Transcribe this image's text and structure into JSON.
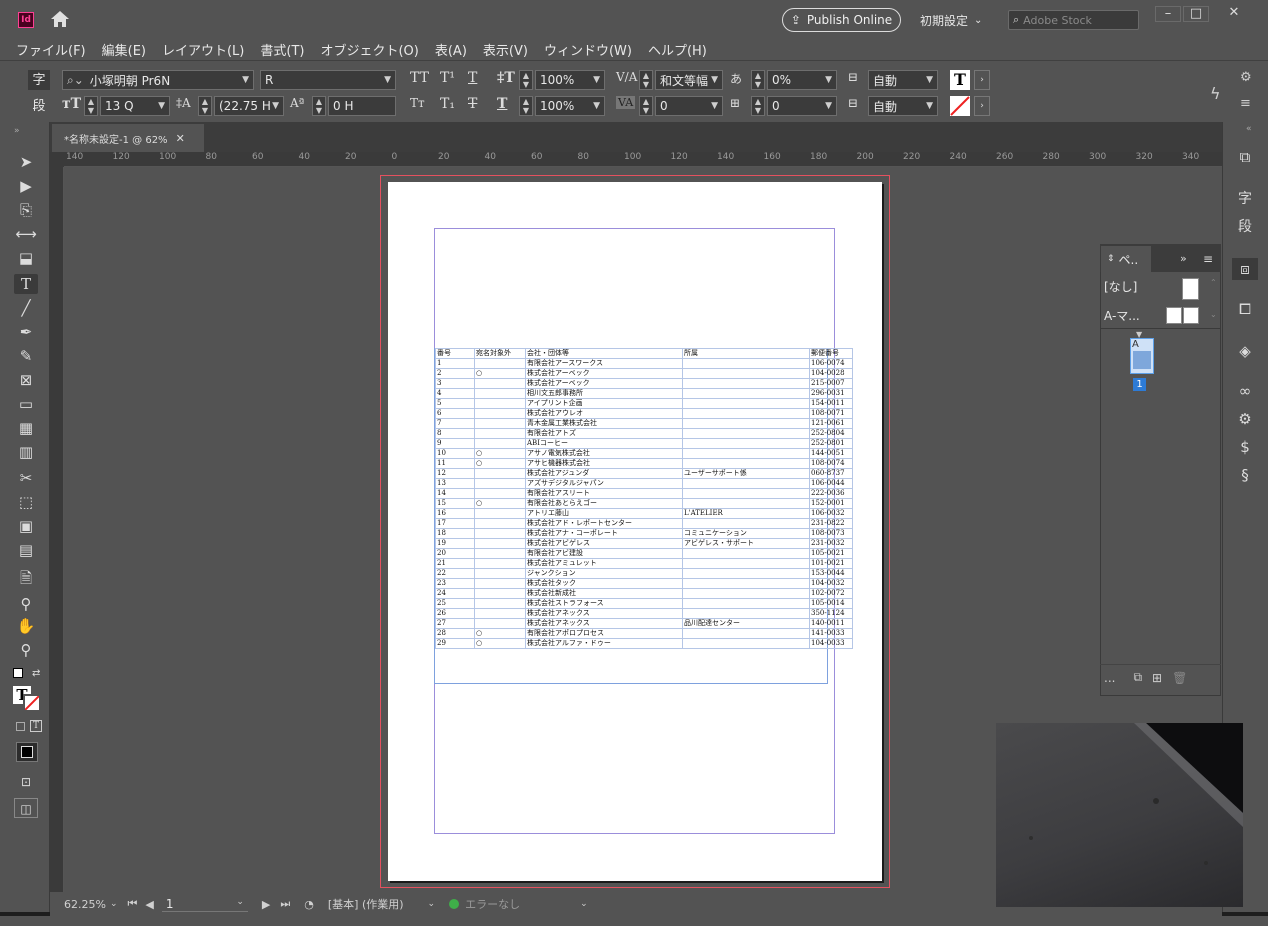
{
  "titlebar": {
    "app_logo": "Id",
    "publish_label": "Publish Online",
    "workspace_label": "初期設定",
    "stock_placeholder": "Adobe Stock"
  },
  "menu": [
    "ファイル(F)",
    "編集(E)",
    "レイアウト(L)",
    "書式(T)",
    "オブジェクト(O)",
    "表(A)",
    "表示(V)",
    "ウィンドウ(W)",
    "ヘルプ(H)"
  ],
  "control": {
    "char_mode": "字",
    "para_mode": "段",
    "font_family": "小塚明朝 Pr6N",
    "font_style": "R",
    "font_size": "13 Q",
    "leading": "(22.75 H",
    "baseline_shift": "0 H",
    "vertical_scale": "100%",
    "horizontal_scale": "100%",
    "kerning": "和文等幅",
    "tracking": "0",
    "tsume": "0%",
    "aki_value": "0",
    "auto1": "自動",
    "auto2": "自動"
  },
  "document_tab": {
    "title": "*名称未設定-1 @ 62%"
  },
  "ruler_labels": [
    "140",
    "120",
    "100",
    "80",
    "60",
    "40",
    "20",
    "0",
    "20",
    "40",
    "60",
    "80",
    "100",
    "120",
    "140",
    "160",
    "180",
    "200",
    "220",
    "240",
    "260",
    "280",
    "300",
    "320",
    "340"
  ],
  "table": {
    "headers": [
      "番号",
      "宛名対象外",
      "会社・団体等",
      "所属",
      "郵便番号"
    ],
    "rows": [
      [
        "1",
        "",
        "有限会社アースワークス",
        "",
        "106-0074"
      ],
      [
        "2",
        "○",
        "株式会社アーベック",
        "",
        "104-0028"
      ],
      [
        "3",
        "",
        "株式会社アーベック",
        "",
        "215-0007"
      ],
      [
        "4",
        "",
        "相川文五郎事務所",
        "",
        "296-0031"
      ],
      [
        "5",
        "",
        "アイプリント企画",
        "",
        "154-0011"
      ],
      [
        "6",
        "",
        "株式会社アウレオ",
        "",
        "108-0071"
      ],
      [
        "7",
        "",
        "青木金属工業株式会社",
        "",
        "121-0061"
      ],
      [
        "8",
        "",
        "有限会社アトズ",
        "",
        "252-0804"
      ],
      [
        "9",
        "",
        "ABIコーヒー",
        "",
        "252-0801"
      ],
      [
        "10",
        "○",
        "アサノ電気株式会社",
        "",
        "144-0051"
      ],
      [
        "11",
        "○",
        "アサヒ機器株式会社",
        "",
        "108-0074"
      ],
      [
        "12",
        "",
        "株式会社アジュンダ",
        "ユーザーサポート係",
        "060-8737"
      ],
      [
        "13",
        "",
        "アズサデジタルジャパン",
        "",
        "106-0044"
      ],
      [
        "14",
        "",
        "有限会社アスリート",
        "",
        "222-0036"
      ],
      [
        "15",
        "○",
        "有限会社あとらえゴー",
        "",
        "152-0001"
      ],
      [
        "16",
        "",
        "アトリエ藤山",
        "L'ATELIER",
        "106-0032"
      ],
      [
        "17",
        "",
        "株式会社アド・レポートセンター",
        "",
        "231-0822"
      ],
      [
        "18",
        "",
        "株式会社アナ・コーポレート",
        "コミュニケーション",
        "108-0073"
      ],
      [
        "19",
        "",
        "株式会社アビゲレス",
        "アビゲレス・サポート",
        "231-0032"
      ],
      [
        "20",
        "",
        "有限会社アビ建設",
        "",
        "105-0021"
      ],
      [
        "21",
        "",
        "株式会社アミュレット",
        "",
        "101-0021"
      ],
      [
        "22",
        "",
        "ジャンクション",
        "",
        "153-0044"
      ],
      [
        "23",
        "",
        "株式会社タック",
        "",
        "104-0032"
      ],
      [
        "24",
        "",
        "株式会社新成社",
        "",
        "102-0072"
      ],
      [
        "25",
        "",
        "株式会社ストラフォース",
        "",
        "105-0014"
      ],
      [
        "26",
        "",
        "株式会社アネックス",
        "",
        "350-1124"
      ],
      [
        "27",
        "",
        "株式会社アネックス",
        "品川配達センター",
        "140-0011"
      ],
      [
        "28",
        "○",
        "有限会社アポロプロセス",
        "",
        "141-0033"
      ],
      [
        "29",
        "○",
        "株式会社アルファ・ドゥー",
        "",
        "104-0033"
      ]
    ]
  },
  "pages_panel": {
    "tab_label": "ペ..",
    "none_master": "[なし]",
    "a_master": "A-マ...",
    "page_master_letter": "A",
    "page_number": "1",
    "footer_more": "..."
  },
  "statusbar": {
    "zoom": "62.25%",
    "page_field": "1",
    "preflight_profile": "[基本] (作業用)",
    "error_status": "エラーなし"
  },
  "colors": {
    "ui_gray": "#535353",
    "bleed_red": "#e4515f",
    "margin_purple": "#9b8edb",
    "frame_blue": "#7ea1de",
    "ok_green": "#3fae49",
    "page_selected": "#2d7bd6"
  }
}
